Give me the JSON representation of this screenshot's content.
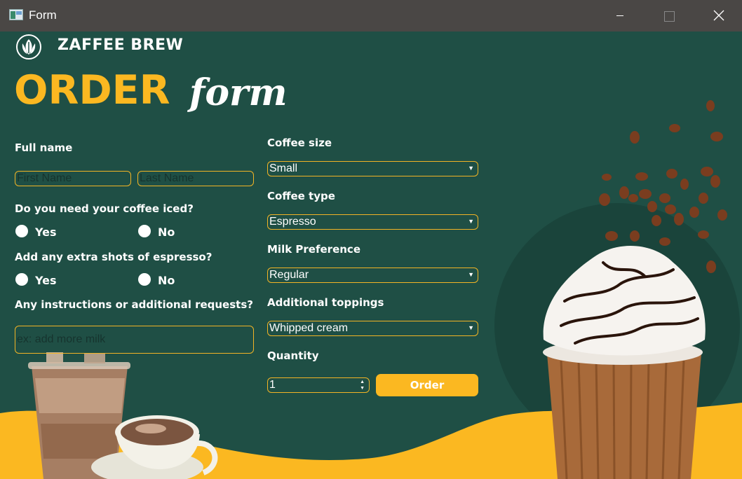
{
  "window": {
    "title": "Form"
  },
  "brand": {
    "name": "ZAFFEE BREW"
  },
  "heading": {
    "order": "ORDER",
    "form": "form"
  },
  "left_form": {
    "full_name_label": "Full name",
    "first_name_placeholder": "First Name",
    "last_name_placeholder": "Last Name",
    "iced_question": "Do you need your coffee iced?",
    "iced_yes": "Yes",
    "iced_no": "No",
    "shots_question": "Add any extra shots of espresso?",
    "shots_yes": "Yes",
    "shots_no": "No",
    "instructions_label": "Any instructions or additional requests?",
    "instructions_placeholder": "ex: add more milk"
  },
  "right_form": {
    "size_label": "Coffee size",
    "size_value": "Small",
    "type_label": "Coffee type",
    "type_value": "Espresso",
    "milk_label": "Milk Preference",
    "milk_value": "Regular",
    "toppings_label": "Additional toppings",
    "toppings_value": "Whipped cream",
    "quantity_label": "Quantity",
    "quantity_value": "1",
    "order_button": "Order"
  },
  "colors": {
    "background": "#1f4f45",
    "accent_yellow": "#fbb821",
    "titlebar": "#4a4745"
  },
  "icons": {
    "app": "window-icon",
    "logo": "leaf-logo-icon",
    "minimize": "minimize-icon",
    "maximize": "maximize-icon",
    "close": "close-icon"
  }
}
